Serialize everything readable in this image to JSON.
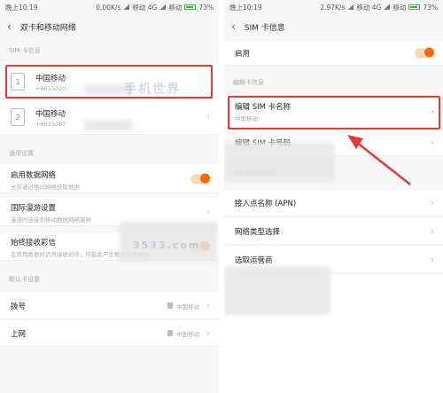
{
  "left": {
    "status": {
      "time": "晚上10:19",
      "speed": "0.00K/s",
      "carrier": "移动 4G",
      "carrier2": "移动",
      "battery": "73%"
    },
    "title": "双卡和移动网络",
    "sim_section": "SIM 卡信息",
    "sims": [
      {
        "slot": "1",
        "name": "中国移动",
        "number": "+8615020"
      },
      {
        "slot": "2",
        "name": "中国移动",
        "number": "+8615087"
      }
    ],
    "common_section": "通用设置",
    "settings": [
      {
        "title": "启用数据网络",
        "sub": "允许通过移动网络获取数据"
      },
      {
        "title": "国际漫游设置",
        "sub": "漫游时连接到移动数据网络服务"
      },
      {
        "title": "始终接收彩信",
        "sub": "在禁用数据时仍然接收彩信，可能会产生数据流量费用"
      }
    ],
    "default_section": "默认卡设置",
    "defaults": [
      {
        "title": "拨号",
        "value": "中国移动"
      },
      {
        "title": "上网",
        "value": "中国移动"
      }
    ]
  },
  "right": {
    "status": {
      "time": "晚上10:19",
      "speed": "2.97K/s",
      "carrier": "移动 4G",
      "carrier2": "移动",
      "battery": "73%"
    },
    "title": "SIM 卡信息",
    "enable_label": "启用",
    "edit_section": "编辑卡信息",
    "edit_name": {
      "title": "编辑 SIM 卡名称",
      "sub": "中国移动"
    },
    "edit_number": {
      "title": "编辑 SIM 卡号码"
    },
    "network_section": "运营商网络设置",
    "network_items": [
      {
        "title": "接入点名称 (APN)"
      },
      {
        "title": "网络类型选择"
      },
      {
        "title": "选取运营商"
      }
    ]
  },
  "watermark": {
    "brand": "手机世界",
    "site": "3533.com"
  },
  "colors": {
    "accent": "#ff6a00",
    "highlight": "#e53935"
  }
}
